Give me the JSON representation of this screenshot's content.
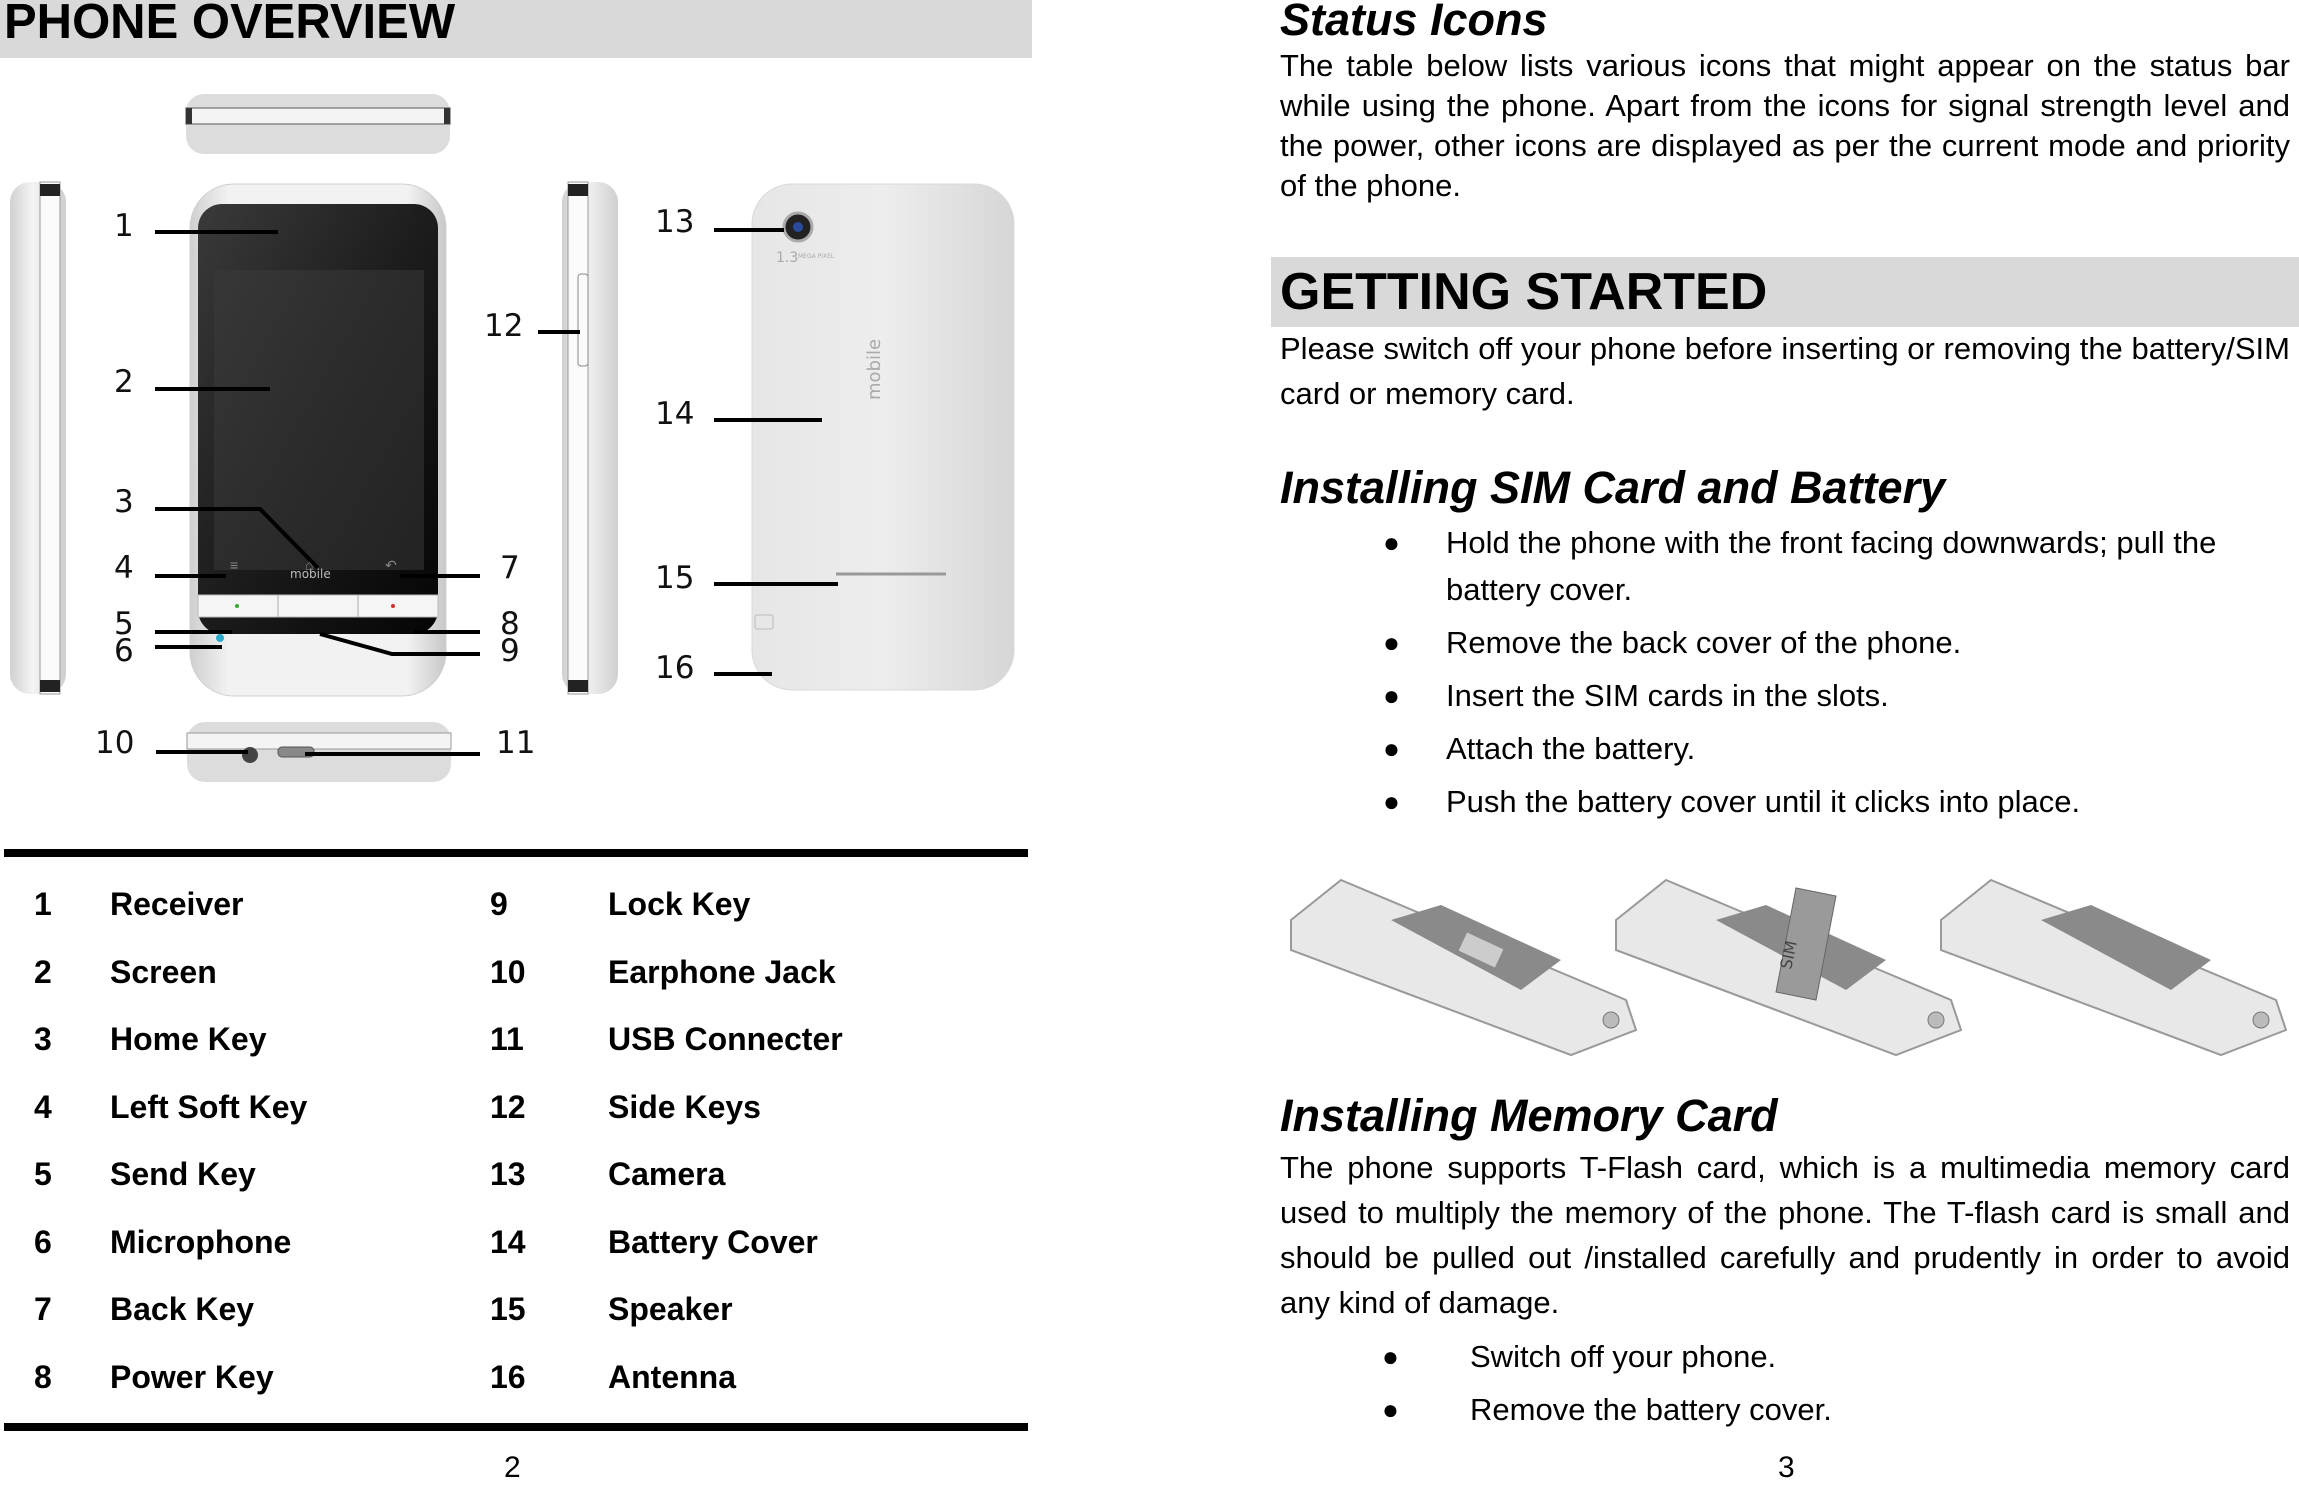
{
  "left_page": {
    "section_title": "PHONE OVERVIEW",
    "figure": {
      "callouts": [
        "1",
        "2",
        "3",
        "4",
        "5",
        "6",
        "7",
        "8",
        "9",
        "10",
        "11",
        "12",
        "13",
        "14",
        "15",
        "16"
      ],
      "back_camera_label": "1.3",
      "back_camera_sub": "MEGA PIXEL",
      "brand_logo": "mobile"
    },
    "parts_table": {
      "rows": [
        {
          "num1": "1",
          "name1": "Receiver",
          "num2": "9",
          "name2": "Lock Key"
        },
        {
          "num1": "2",
          "name1": "Screen",
          "num2": "10",
          "name2": "Earphone Jack"
        },
        {
          "num1": "3",
          "name1": "Home Key",
          "num2": "11",
          "name2": "USB Connecter"
        },
        {
          "num1": "4",
          "name1": "Left Soft Key",
          "num2": "12",
          "name2": "Side Keys"
        },
        {
          "num1": "5",
          "name1": "Send Key",
          "num2": "13",
          "name2": "Camera"
        },
        {
          "num1": "6",
          "name1": "Microphone",
          "num2": "14",
          "name2": "Battery Cover"
        },
        {
          "num1": "7",
          "name1": "Back Key",
          "num2": "15",
          "name2": "Speaker"
        },
        {
          "num1": "8",
          "name1": "Power Key",
          "num2": "16",
          "name2": "Antenna"
        }
      ]
    },
    "page_number": "2"
  },
  "right_page": {
    "status_icons": {
      "title": "Status Icons",
      "body": "The table below lists various icons that might appear on the status bar while using the phone. Apart from the icons for signal strength level and the power, other icons are displayed as per the current mode and priority of the phone."
    },
    "getting_started": {
      "title": "GETTING STARTED",
      "body": "Please switch off your phone before inserting or removing the battery/SIM card or memory card."
    },
    "installing_sim": {
      "title": "Installing SIM Card and Battery",
      "steps": [
        "Hold the phone with the front facing downwards; pull the battery cover.",
        "Remove the back cover of the phone.",
        "Insert the SIM cards in the slots.",
        "Attach the battery.",
        "Push the battery cover until it clicks into place."
      ],
      "figure_sim_label": "SIM"
    },
    "installing_memory": {
      "title": "Installing Memory Card",
      "body": "The phone supports T-Flash card, which is a multimedia memory card used to multiply the memory of the phone. The T-flash card is small and should be pulled out /installed carefully and prudently in order to avoid any kind of damage.",
      "steps": [
        "Switch off your phone.",
        "Remove the battery cover."
      ]
    },
    "page_number": "3"
  },
  "colors": {
    "section_band": "#d9d9d9",
    "text": "#000000"
  }
}
